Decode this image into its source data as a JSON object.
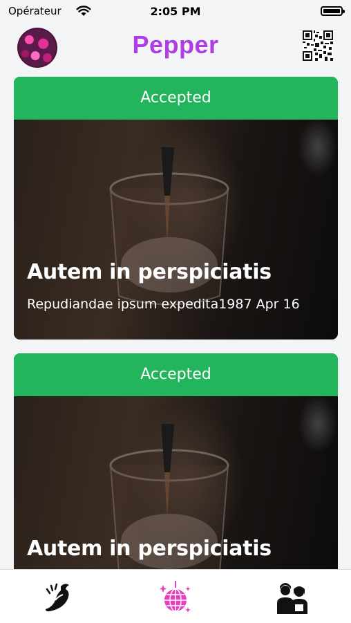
{
  "status_bar": {
    "carrier": "Opérateur",
    "time": "2:05 PM"
  },
  "header": {
    "title": "Pepper",
    "title_color": "#b13ce6"
  },
  "cards": [
    {
      "status": "Accepted",
      "title": "Autem in perspiciatis",
      "subtitle": "Repudiandae ipsum expedita",
      "date": "1987 Apr 16"
    },
    {
      "status": "Accepted",
      "title": "Autem in perspiciatis"
    }
  ],
  "colors": {
    "accepted": "#22b55b",
    "accent": "#b13ce6",
    "pink": "#e63fbf"
  },
  "tabs": [
    {
      "icon": "pepper-icon"
    },
    {
      "icon": "disco-ball-icon",
      "active": true
    },
    {
      "icon": "people-icon"
    }
  ]
}
